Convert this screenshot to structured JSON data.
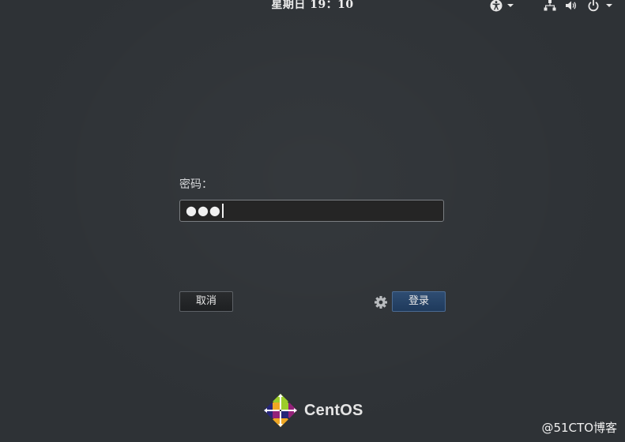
{
  "topbar": {
    "clock": "星期日 19：10",
    "icons": [
      "accessibility-icon",
      "network-icon",
      "volume-icon",
      "power-icon"
    ]
  },
  "login": {
    "prompt_label": "密码：",
    "password_mask": "●●●",
    "cancel_label": "取消",
    "login_label": "登录"
  },
  "branding": {
    "logo_text": "CentOS",
    "watermark": "@51CTO博客"
  },
  "colors": {
    "background": "#2e3236",
    "login_button": "#2f4d72"
  }
}
